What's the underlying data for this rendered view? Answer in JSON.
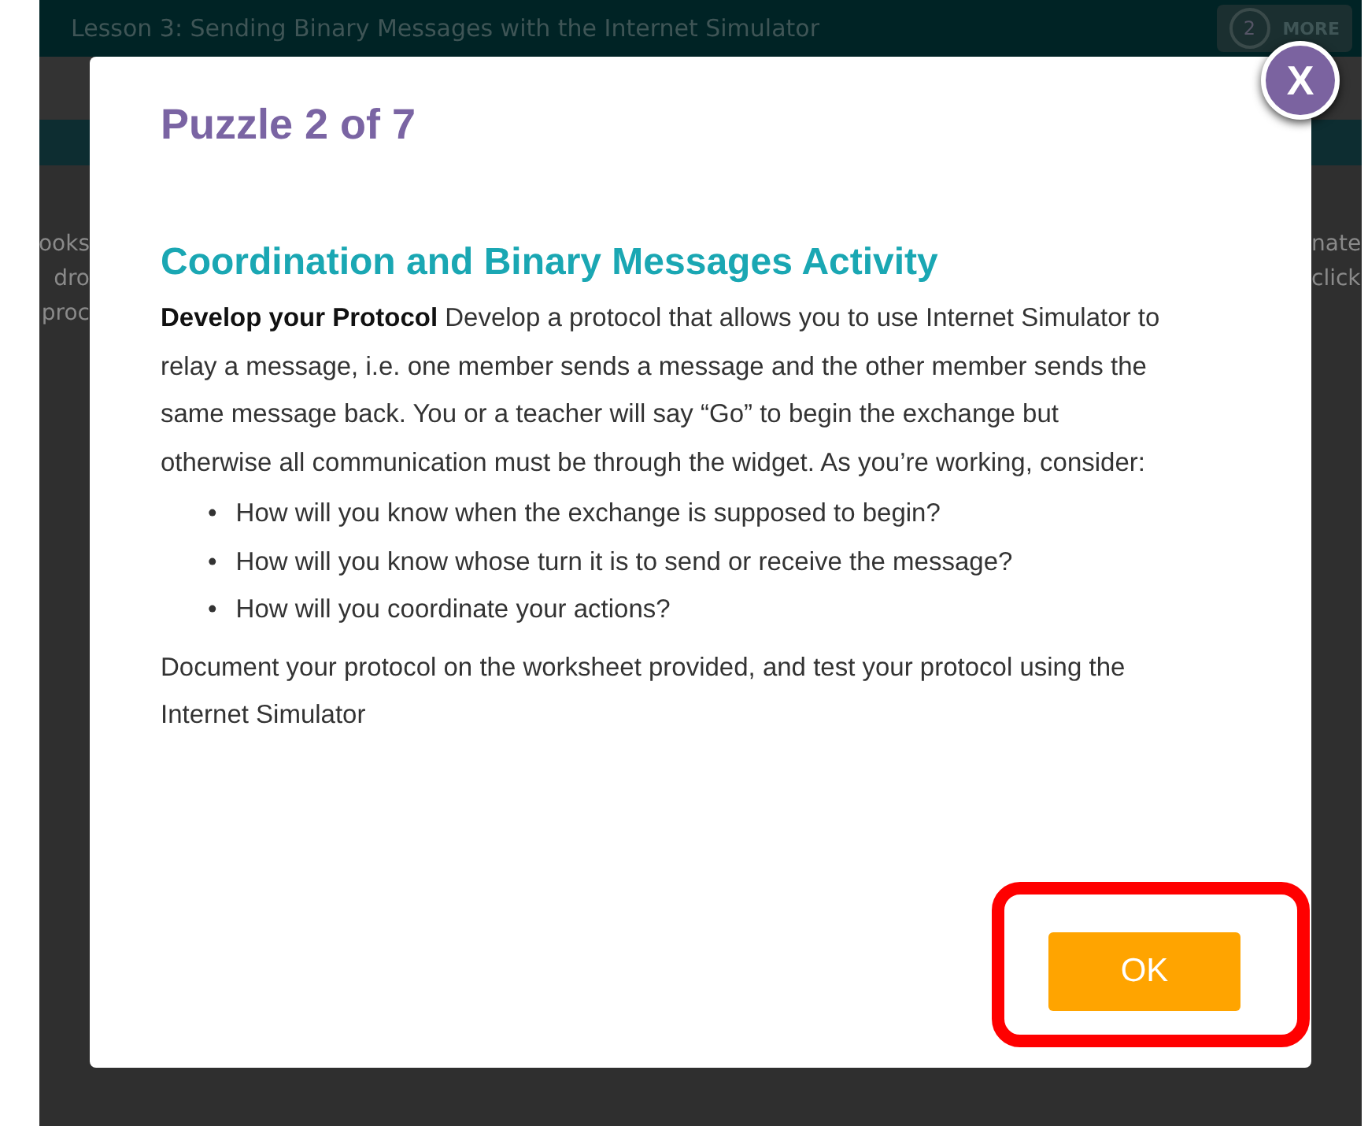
{
  "header": {
    "title": "Lesson 3: Sending Binary Messages with the Internet Simulator",
    "level_badge": "2",
    "more": "MORE"
  },
  "background_left": [
    "ooks",
    "dro",
    "proc"
  ],
  "background_right": [
    "nate",
    "click"
  ],
  "dialog": {
    "title": "Puzzle 2 of 7",
    "close": "X",
    "heading": "Coordination and Binary Messages Activity",
    "intro": "**Develop your Protocol** Develop a protocol that allows you to use Internet Simulator to relay a message, i.e. one member sends a message and the other member sends the same message back. You or a teacher will say “Go” to begin the exchange but otherwise all communication must be through the widget. As you’re working, consider:",
    "bullet_mark": "•",
    "bullets": [
      "How will you know when the exchange is supposed to begin?",
      "How will you know whose turn it is to send or receive the message?",
      "How will you coordinate your actions?"
    ],
    "closing": "Document your protocol on the worksheet provided, and test your protocol using the Internet Simulator",
    "button": "OK"
  }
}
